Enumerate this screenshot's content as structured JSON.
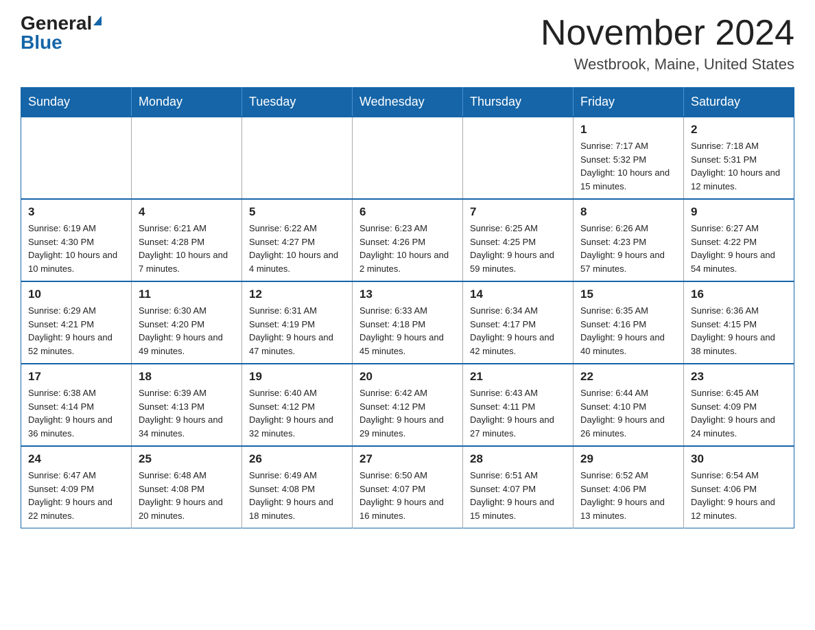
{
  "header": {
    "logo_general": "General",
    "logo_blue": "Blue",
    "month_title": "November 2024",
    "location": "Westbrook, Maine, United States"
  },
  "weekdays": [
    "Sunday",
    "Monday",
    "Tuesday",
    "Wednesday",
    "Thursday",
    "Friday",
    "Saturday"
  ],
  "weeks": [
    [
      {
        "day": "",
        "sunrise": "",
        "sunset": "",
        "daylight": ""
      },
      {
        "day": "",
        "sunrise": "",
        "sunset": "",
        "daylight": ""
      },
      {
        "day": "",
        "sunrise": "",
        "sunset": "",
        "daylight": ""
      },
      {
        "day": "",
        "sunrise": "",
        "sunset": "",
        "daylight": ""
      },
      {
        "day": "",
        "sunrise": "",
        "sunset": "",
        "daylight": ""
      },
      {
        "day": "1",
        "sunrise": "Sunrise: 7:17 AM",
        "sunset": "Sunset: 5:32 PM",
        "daylight": "Daylight: 10 hours and 15 minutes."
      },
      {
        "day": "2",
        "sunrise": "Sunrise: 7:18 AM",
        "sunset": "Sunset: 5:31 PM",
        "daylight": "Daylight: 10 hours and 12 minutes."
      }
    ],
    [
      {
        "day": "3",
        "sunrise": "Sunrise: 6:19 AM",
        "sunset": "Sunset: 4:30 PM",
        "daylight": "Daylight: 10 hours and 10 minutes."
      },
      {
        "day": "4",
        "sunrise": "Sunrise: 6:21 AM",
        "sunset": "Sunset: 4:28 PM",
        "daylight": "Daylight: 10 hours and 7 minutes."
      },
      {
        "day": "5",
        "sunrise": "Sunrise: 6:22 AM",
        "sunset": "Sunset: 4:27 PM",
        "daylight": "Daylight: 10 hours and 4 minutes."
      },
      {
        "day": "6",
        "sunrise": "Sunrise: 6:23 AM",
        "sunset": "Sunset: 4:26 PM",
        "daylight": "Daylight: 10 hours and 2 minutes."
      },
      {
        "day": "7",
        "sunrise": "Sunrise: 6:25 AM",
        "sunset": "Sunset: 4:25 PM",
        "daylight": "Daylight: 9 hours and 59 minutes."
      },
      {
        "day": "8",
        "sunrise": "Sunrise: 6:26 AM",
        "sunset": "Sunset: 4:23 PM",
        "daylight": "Daylight: 9 hours and 57 minutes."
      },
      {
        "day": "9",
        "sunrise": "Sunrise: 6:27 AM",
        "sunset": "Sunset: 4:22 PM",
        "daylight": "Daylight: 9 hours and 54 minutes."
      }
    ],
    [
      {
        "day": "10",
        "sunrise": "Sunrise: 6:29 AM",
        "sunset": "Sunset: 4:21 PM",
        "daylight": "Daylight: 9 hours and 52 minutes."
      },
      {
        "day": "11",
        "sunrise": "Sunrise: 6:30 AM",
        "sunset": "Sunset: 4:20 PM",
        "daylight": "Daylight: 9 hours and 49 minutes."
      },
      {
        "day": "12",
        "sunrise": "Sunrise: 6:31 AM",
        "sunset": "Sunset: 4:19 PM",
        "daylight": "Daylight: 9 hours and 47 minutes."
      },
      {
        "day": "13",
        "sunrise": "Sunrise: 6:33 AM",
        "sunset": "Sunset: 4:18 PM",
        "daylight": "Daylight: 9 hours and 45 minutes."
      },
      {
        "day": "14",
        "sunrise": "Sunrise: 6:34 AM",
        "sunset": "Sunset: 4:17 PM",
        "daylight": "Daylight: 9 hours and 42 minutes."
      },
      {
        "day": "15",
        "sunrise": "Sunrise: 6:35 AM",
        "sunset": "Sunset: 4:16 PM",
        "daylight": "Daylight: 9 hours and 40 minutes."
      },
      {
        "day": "16",
        "sunrise": "Sunrise: 6:36 AM",
        "sunset": "Sunset: 4:15 PM",
        "daylight": "Daylight: 9 hours and 38 minutes."
      }
    ],
    [
      {
        "day": "17",
        "sunrise": "Sunrise: 6:38 AM",
        "sunset": "Sunset: 4:14 PM",
        "daylight": "Daylight: 9 hours and 36 minutes."
      },
      {
        "day": "18",
        "sunrise": "Sunrise: 6:39 AM",
        "sunset": "Sunset: 4:13 PM",
        "daylight": "Daylight: 9 hours and 34 minutes."
      },
      {
        "day": "19",
        "sunrise": "Sunrise: 6:40 AM",
        "sunset": "Sunset: 4:12 PM",
        "daylight": "Daylight: 9 hours and 32 minutes."
      },
      {
        "day": "20",
        "sunrise": "Sunrise: 6:42 AM",
        "sunset": "Sunset: 4:12 PM",
        "daylight": "Daylight: 9 hours and 29 minutes."
      },
      {
        "day": "21",
        "sunrise": "Sunrise: 6:43 AM",
        "sunset": "Sunset: 4:11 PM",
        "daylight": "Daylight: 9 hours and 27 minutes."
      },
      {
        "day": "22",
        "sunrise": "Sunrise: 6:44 AM",
        "sunset": "Sunset: 4:10 PM",
        "daylight": "Daylight: 9 hours and 26 minutes."
      },
      {
        "day": "23",
        "sunrise": "Sunrise: 6:45 AM",
        "sunset": "Sunset: 4:09 PM",
        "daylight": "Daylight: 9 hours and 24 minutes."
      }
    ],
    [
      {
        "day": "24",
        "sunrise": "Sunrise: 6:47 AM",
        "sunset": "Sunset: 4:09 PM",
        "daylight": "Daylight: 9 hours and 22 minutes."
      },
      {
        "day": "25",
        "sunrise": "Sunrise: 6:48 AM",
        "sunset": "Sunset: 4:08 PM",
        "daylight": "Daylight: 9 hours and 20 minutes."
      },
      {
        "day": "26",
        "sunrise": "Sunrise: 6:49 AM",
        "sunset": "Sunset: 4:08 PM",
        "daylight": "Daylight: 9 hours and 18 minutes."
      },
      {
        "day": "27",
        "sunrise": "Sunrise: 6:50 AM",
        "sunset": "Sunset: 4:07 PM",
        "daylight": "Daylight: 9 hours and 16 minutes."
      },
      {
        "day": "28",
        "sunrise": "Sunrise: 6:51 AM",
        "sunset": "Sunset: 4:07 PM",
        "daylight": "Daylight: 9 hours and 15 minutes."
      },
      {
        "day": "29",
        "sunrise": "Sunrise: 6:52 AM",
        "sunset": "Sunset: 4:06 PM",
        "daylight": "Daylight: 9 hours and 13 minutes."
      },
      {
        "day": "30",
        "sunrise": "Sunrise: 6:54 AM",
        "sunset": "Sunset: 4:06 PM",
        "daylight": "Daylight: 9 hours and 12 minutes."
      }
    ]
  ]
}
